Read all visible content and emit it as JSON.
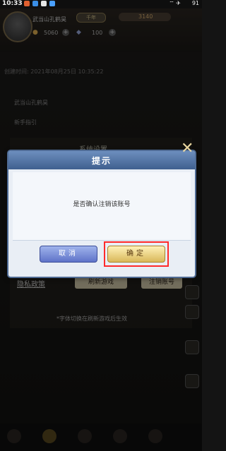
{
  "status_bar": {
    "time": "10:33",
    "right": "91"
  },
  "hud": {
    "player_name": "武当山孔鹤昊",
    "rank": "千年",
    "gold": "3140",
    "stat1": "5060",
    "stat2": "100"
  },
  "background": {
    "created_time": "创建时间: 2021年08月25日 10:35:22",
    "row1": "武当山孔鹤昊",
    "row2": "新手指引",
    "settings_title": "系统设置",
    "privacy": "隐私政策",
    "refresh_button": "刷新游戏",
    "logout_button": "注销账号",
    "footnote": "*字体切换在刷新游戏后生效"
  },
  "dialog": {
    "title": "提示",
    "message": "是否确认注销该账号",
    "cancel_label": "取消",
    "ok_label": "确定"
  },
  "colors": {
    "highlight": "#ff2a2a",
    "dialog_header": "#4f6b94",
    "cancel_button": "#6f84d4",
    "ok_button": "#e6c56a"
  }
}
